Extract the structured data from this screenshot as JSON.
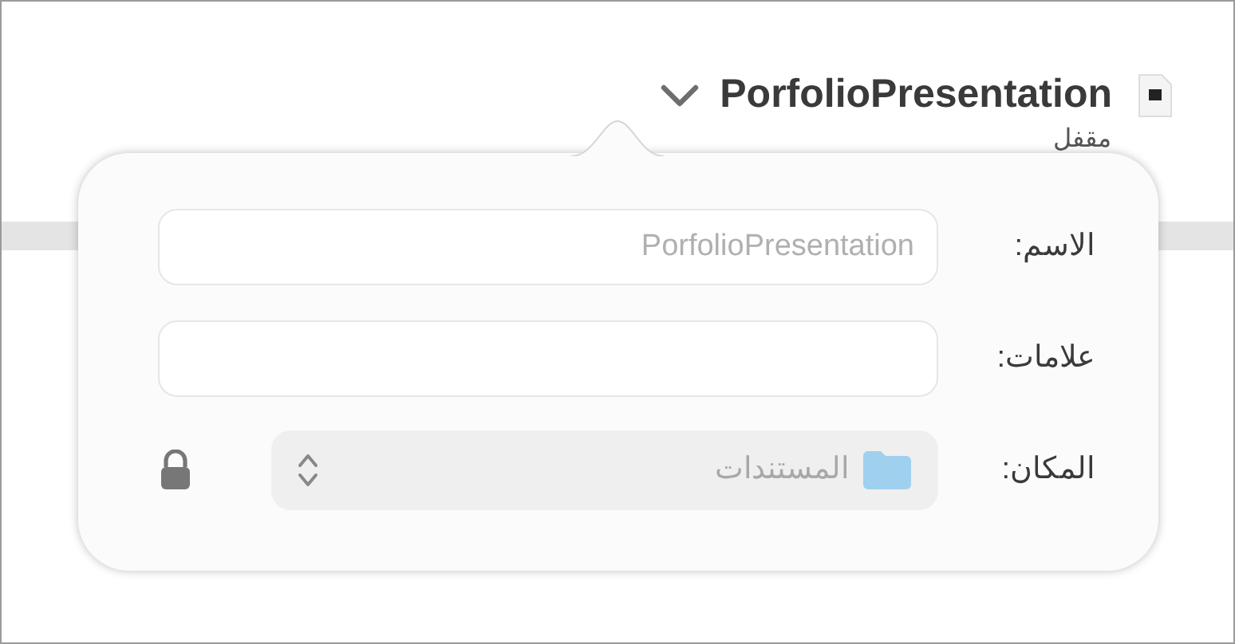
{
  "document": {
    "title": "PorfolioPresentation",
    "status": "مقفل"
  },
  "popover": {
    "rows": [
      {
        "kind": "text",
        "label": "الاسم:",
        "value": "PorfolioPresentation",
        "disabled": true
      },
      {
        "kind": "text",
        "label": "علامات:"
      },
      {
        "kind": "select",
        "label": "المكان:",
        "value": "المستندات",
        "disabled": true,
        "locked": true
      }
    ]
  }
}
